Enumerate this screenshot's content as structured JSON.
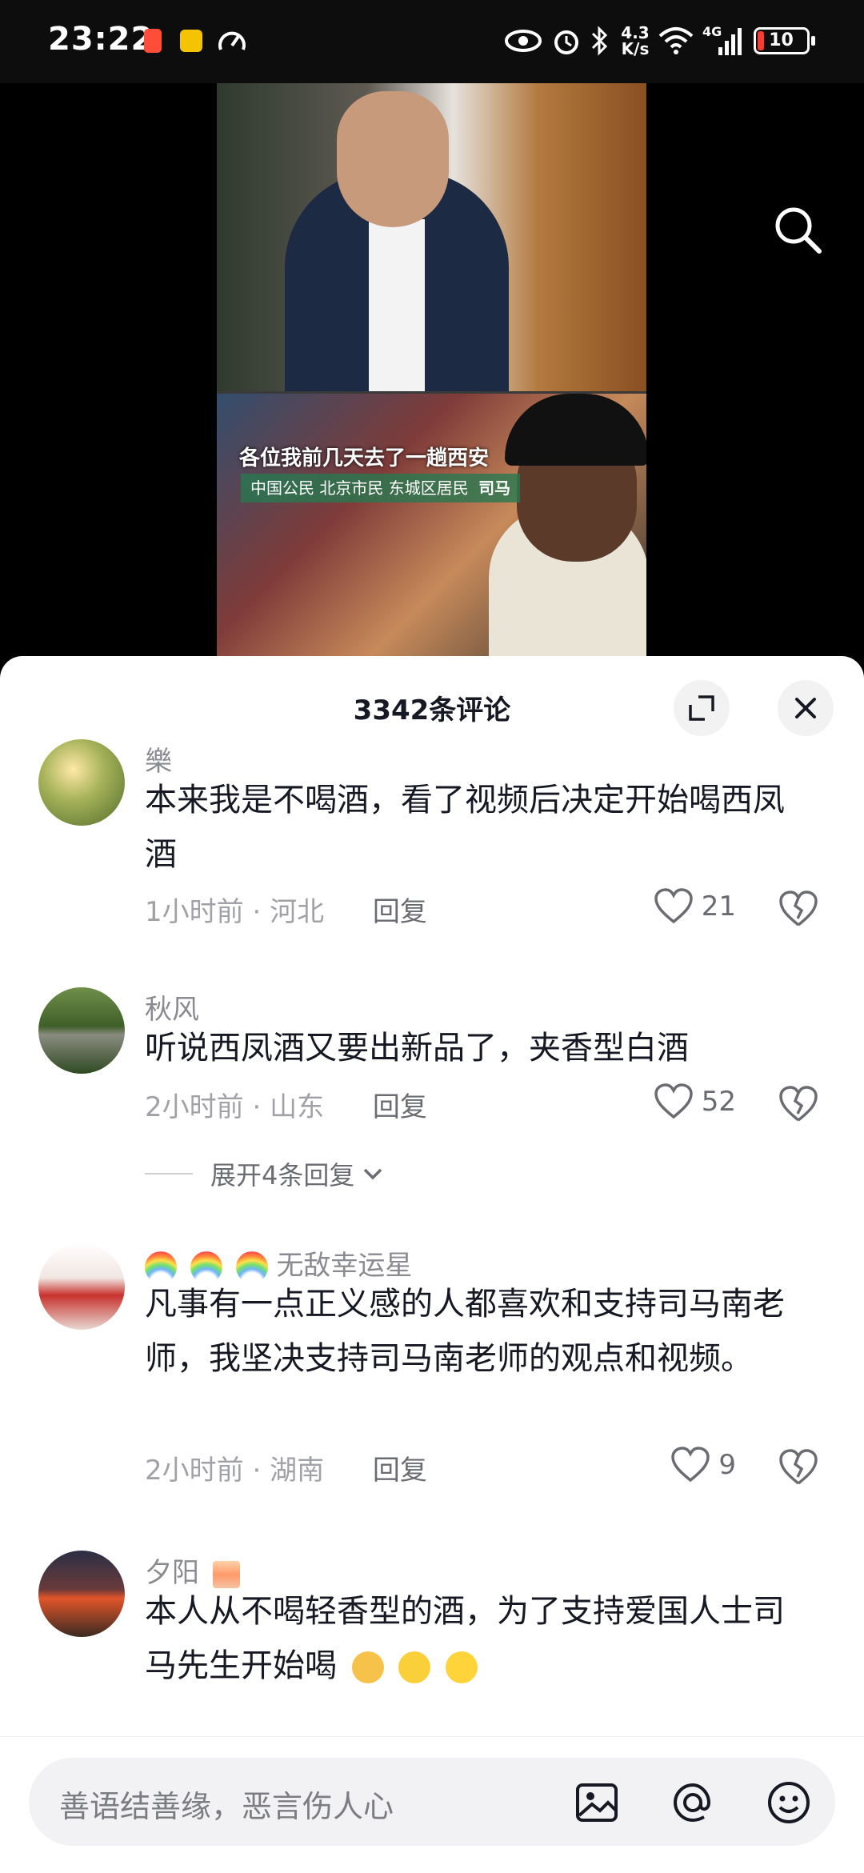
{
  "status_bar": {
    "time": "23:22",
    "network_speed_value": "4.3",
    "network_speed_unit": "K/s",
    "network_type": "4G",
    "battery_level": "10"
  },
  "video": {
    "caption": "各位我前几天去了一趟西安",
    "name_tag_prefix": "中国公民 北京市民 东城区居民",
    "name_tag_name": "司马"
  },
  "comments_panel": {
    "title": "3342条评论",
    "comments": [
      {
        "username": "樂",
        "text": "本来我是不喝酒，看了视频后决定开始喝西凤酒",
        "time": "1小时前",
        "location": "河北",
        "reply_label": "回复",
        "likes": "21",
        "avatar_color": "#6b8f3a"
      },
      {
        "username": "秋风",
        "text": "听说西凤酒又要出新品了，夹香型白酒",
        "time": "2小时前",
        "location": "山东",
        "reply_label": "回复",
        "likes": "52",
        "avatar_color": "#4f6b3f",
        "expand_label": "展开4条回复"
      },
      {
        "username": "无敌幸运星",
        "text": "凡事有一点正义感的人都喜欢和支持司马南老师，我坚决支持司马南老师的观点和视频。",
        "time": "2小时前",
        "location": "湖南",
        "reply_label": "回复",
        "likes": "9",
        "avatar_color": "#e7d7d0"
      },
      {
        "username": "夕阳",
        "text": "本人从不喝轻香型的酒，为了支持爱国人士司马先生开始喝",
        "avatar_color": "#8a3a2a"
      }
    ]
  },
  "input_bar": {
    "placeholder": "善语结善缘，恶言伤人心"
  },
  "icons": {
    "search": "search-icon",
    "expand": "expand-icon",
    "close": "close-icon",
    "like": "heart-icon",
    "dislike": "broken-heart-icon",
    "image": "image-icon",
    "mention": "at-icon",
    "emoji": "emoji-icon"
  }
}
